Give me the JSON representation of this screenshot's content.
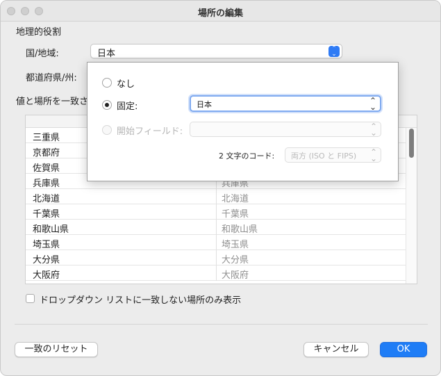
{
  "window": {
    "title": "場所の編集"
  },
  "section": {
    "geo_role_label": "地理的役割",
    "match_label": "値と場所を一致さ"
  },
  "country": {
    "label": "国/地域:",
    "value": "日本"
  },
  "state": {
    "label": "都道府県/州:"
  },
  "table": {
    "rows": [
      [
        "三重県",
        ""
      ],
      [
        "京都府",
        ""
      ],
      [
        "佐賀県",
        ""
      ],
      [
        "兵庫県",
        "兵庫県"
      ],
      [
        "北海道",
        "北海道"
      ],
      [
        "千葉県",
        "千葉県"
      ],
      [
        "和歌山県",
        "和歌山県"
      ],
      [
        "埼玉県",
        "埼玉県"
      ],
      [
        "大分県",
        "大分県"
      ],
      [
        "大阪府",
        "大阪府"
      ]
    ]
  },
  "checkbox": {
    "label": "ドロップダウン リストに一致しない場所のみ表示"
  },
  "buttons": {
    "reset": "一致のリセット",
    "cancel": "キャンセル",
    "ok": "OK"
  },
  "popover": {
    "none_label": "なし",
    "fixed_label": "固定:",
    "fixed_value": "日本",
    "start_field_label": "開始フィールド:",
    "start_field_value": "",
    "code_label": "2 文字のコード:",
    "code_value": "両方 (ISO と FIPS)",
    "selected": "fixed"
  }
}
